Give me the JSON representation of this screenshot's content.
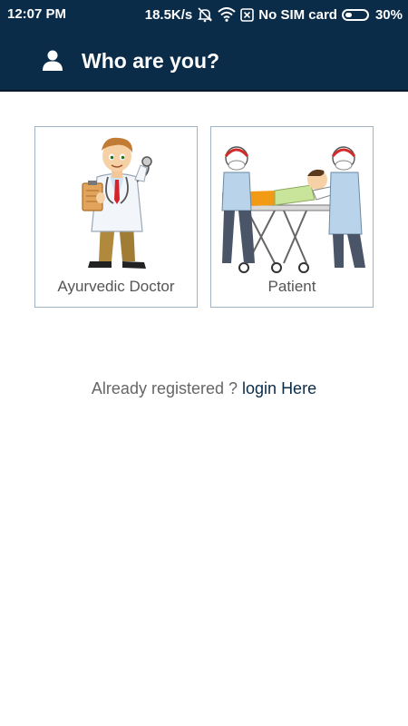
{
  "status_bar": {
    "time": "12:07 PM",
    "network_speed": "18.5K/s",
    "sim_status": "No SIM card",
    "battery": "30%",
    "battery_level": 0.3,
    "icons": [
      "mute-icon",
      "wifi-icon",
      "sim-x-icon",
      "battery-icon"
    ]
  },
  "app_bar": {
    "icon": "user-icon",
    "title": "Who are you?"
  },
  "options": [
    {
      "label": "Ayurvedic Doctor",
      "image": "doctor-illustration"
    },
    {
      "label": "Patient",
      "image": "patient-stretcher-illustration"
    }
  ],
  "login": {
    "prompt": "Already registered ?",
    "link": "login Here"
  },
  "colors": {
    "primary": "#0b2c48",
    "card_border": "#9fb3c6",
    "label_text": "#555555"
  }
}
